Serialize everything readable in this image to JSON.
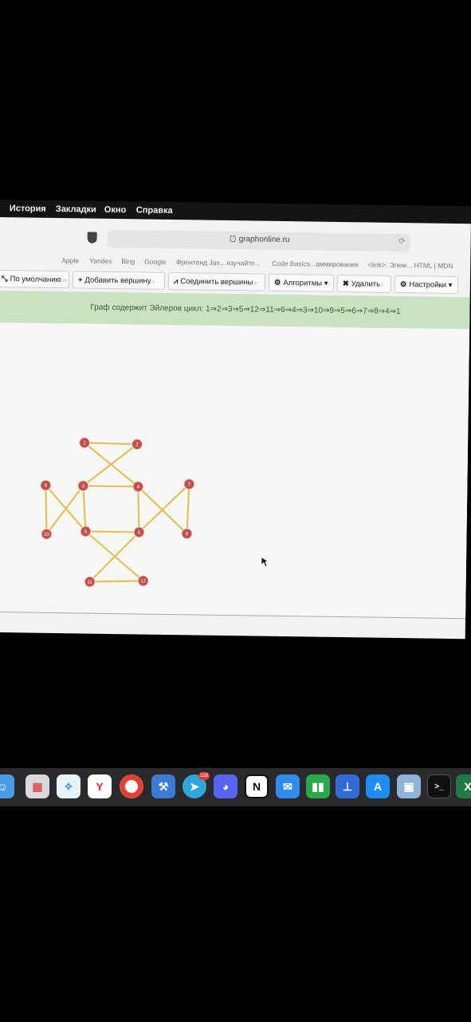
{
  "menubar": {
    "items": [
      "История",
      "Закладки",
      "Окно",
      "Справка"
    ]
  },
  "browser": {
    "url": "graphonline.ru",
    "bookmarks": [
      "Apple",
      "Yandex",
      "Bing",
      "Google",
      "Фронтенд Jav... изучайте...",
      "Code Basics...аммирования",
      "<link>: Элем... HTML | MDN"
    ]
  },
  "toolbar": {
    "default_label": "По умолчанию",
    "default_hint": "m",
    "add_vertex_label": "Добавить вершину",
    "add_vertex_hint": "v",
    "connect_label": "Соединить вершины",
    "connect_hint": "e",
    "algorithms_label": "Алгоритмы",
    "delete_label": "Удалить",
    "delete_hint": "r",
    "settings_label": "Настройки"
  },
  "banner": {
    "text": "Граф содержит Эйлеров цикл: 1⇒2⇒3⇒5⇒12⇒11⇒6⇒4⇒3⇒10⇒9⇒5⇒6⇒7⇒8⇒4⇒1"
  },
  "graph": {
    "edge_color": "#e0c25a",
    "node_color": "#c0504d",
    "nodes": [
      "1",
      "2",
      "3",
      "4",
      "5",
      "6",
      "7",
      "8",
      "9",
      "10",
      "11",
      "12"
    ],
    "edges": [
      [
        "1",
        "2"
      ],
      [
        "2",
        "3"
      ],
      [
        "3",
        "5"
      ],
      [
        "5",
        "12"
      ],
      [
        "12",
        "11"
      ],
      [
        "11",
        "6"
      ],
      [
        "6",
        "4"
      ],
      [
        "4",
        "3"
      ],
      [
        "3",
        "10"
      ],
      [
        "10",
        "9"
      ],
      [
        "9",
        "5"
      ],
      [
        "5",
        "6"
      ],
      [
        "6",
        "7"
      ],
      [
        "7",
        "8"
      ],
      [
        "8",
        "4"
      ],
      [
        "4",
        "1"
      ]
    ]
  },
  "dock": {
    "telegram_badge": "118",
    "apps": [
      "finder-icon",
      "launchpad-icon",
      "safari-icon",
      "yandex-browser-icon",
      "chrome-icon",
      "xcode-icon",
      "telegram-icon",
      "discord-icon",
      "notion-icon",
      "mail-icon",
      "numbers-icon",
      "keynote-icon",
      "app-store-icon",
      "preview-icon",
      "terminal-icon",
      "excel-icon"
    ]
  }
}
